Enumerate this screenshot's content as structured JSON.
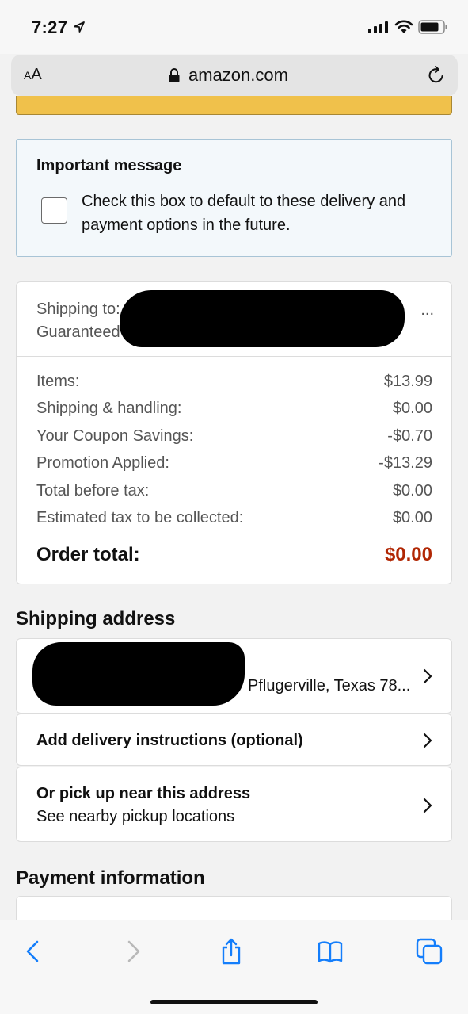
{
  "status_bar": {
    "time": "7:27"
  },
  "browser": {
    "text_size_label_small": "A",
    "text_size_label_large": "A",
    "domain": "amazon.com"
  },
  "important": {
    "title": "Important message",
    "checkbox_text": "Check this box to default to these delivery and payment options in the future.",
    "checked": false
  },
  "shipping": {
    "line1": "Shipping to:",
    "line2": "Guaranteed",
    "ellipsis": "..."
  },
  "summary": {
    "rows": [
      {
        "label": "Items:",
        "value": "$13.99"
      },
      {
        "label": "Shipping & handling:",
        "value": "$0.00"
      },
      {
        "label": "Your Coupon Savings:",
        "value": "-$0.70"
      },
      {
        "label": "Promotion Applied:",
        "value": "-$13.29"
      },
      {
        "label": "Total before tax:",
        "value": "$0.00"
      },
      {
        "label": "Estimated tax to be collected:",
        "value": "$0.00"
      }
    ],
    "total_label": "Order total:",
    "total_value": "$0.00",
    "total_color": "#b12704"
  },
  "shipping_address": {
    "heading": "Shipping address",
    "address_visible": "Pflugerville, Texas 78...",
    "delivery_instructions": "Add delivery instructions (optional)",
    "pickup_title": "Or pick up near this address",
    "pickup_sub": "See nearby pickup locations"
  },
  "payment": {
    "heading": "Payment information"
  },
  "colors": {
    "accent_yellow": "#f0c14b",
    "price_red": "#b12704",
    "ios_blue": "#147efb"
  }
}
